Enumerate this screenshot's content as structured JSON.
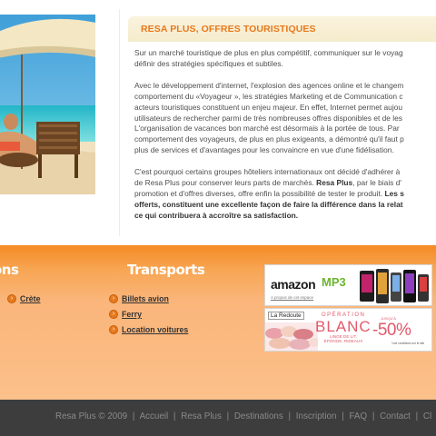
{
  "content": {
    "title": "RESA PLUS, OFFRES TOURISTIQUES",
    "paragraphs": [
      [
        "Sur un marché touristique de plus en plus compétitif, communiquer sur le voyag",
        "définir des stratégies spécifiques et subtiles."
      ],
      [
        "Avec le développement d'internet, l'explosion des agences online et le changem",
        "comportement du «Voyageur », les stratégies Marketing et de Communication c",
        "acteurs touristiques constituent un enjeu majeur. En effet, Internet permet aujou",
        "utilisateurs de rechercher parmi de très nombreuses offres disponibles et de les",
        "L'organisation de vacances bon marché est désormais à la portée de tous. Par",
        "comportement des voyageurs, de plus en plus exigeants, a démontré qu'il faut p",
        "plus de services et d'avantages pour les convaincre en vue d'une fidélisation."
      ]
    ],
    "p3": {
      "l1": "C'est pourquoi certains groupes hôteliers internationaux ont décidé d'adhérer à",
      "l2a": "de Resa Plus pour conserver leurs parts de marchés. ",
      "l2b": "Resa Plus",
      "l2c": ", par le biais d'",
      "l3a": "promotion et d'offres diverses, offre enfin la possibilité de tester le produit. ",
      "l3b": "Les s",
      "l4": "offerts, constituent une excellente façon de faire la différence dans la relat",
      "l5": "ce qui contribuera à accroître sa satisfaction."
    }
  },
  "footer": {
    "col1_title": "ons",
    "col2_title": "Transports",
    "col1_links": [
      {
        "label": "Crète"
      }
    ],
    "col2_links": [
      {
        "label": "Billets avion"
      },
      {
        "label": "Ferry"
      },
      {
        "label": "Location voitures"
      }
    ],
    "ads": {
      "amazon": {
        "word": "amazon",
        "mp3": "MP3",
        "sub": "A propos de cet espace"
      },
      "redoute": {
        "brand": "La Redoute",
        "operation": "OPÉRATION",
        "blanc": "BLANC",
        "linge": "LINGE DE LIT, ÉPONGE, RIDEAUX",
        "jusqua": "JUSQU'À",
        "percent": "-50%",
        "conditions": "*voir conditions sur le site"
      }
    }
  },
  "bottom_nav": {
    "copyright": "Resa Plus © 2009",
    "items": [
      "Accueil",
      "Resa Plus",
      "Destinations",
      "Inscription",
      "FAQ",
      "Contact",
      "Cl"
    ]
  },
  "colors": {
    "accent": "#e8791d",
    "footer_orange": "#f7a552",
    "bottom_bar": "#3d3d3d"
  }
}
